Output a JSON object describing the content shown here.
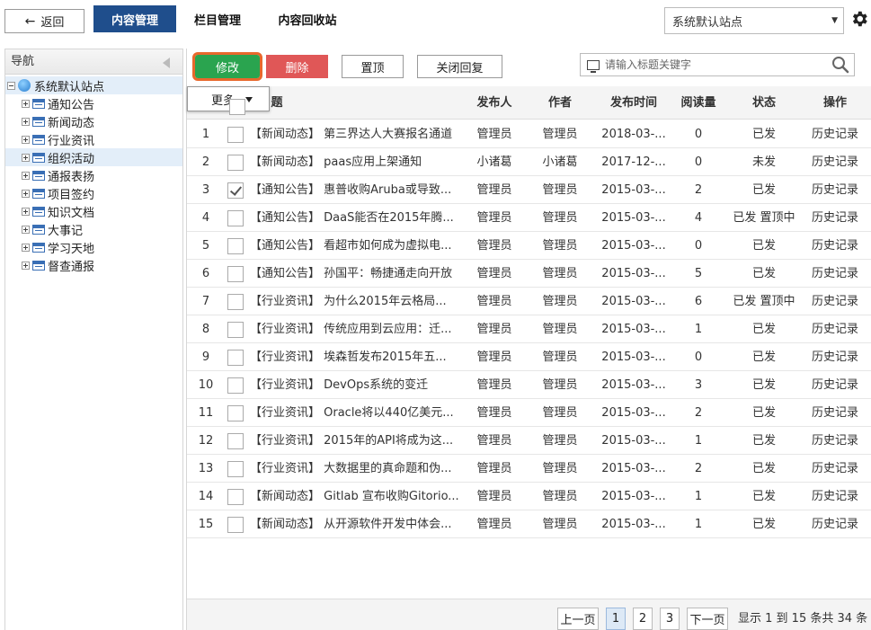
{
  "topbar": {
    "back_label": "返回",
    "tabs": [
      {
        "label": "内容管理",
        "active": true
      },
      {
        "label": "栏目管理",
        "active": false
      },
      {
        "label": "内容回收站",
        "active": false
      }
    ],
    "site_select_value": "系统默认站点"
  },
  "nav": {
    "title": "导航",
    "root": "系统默认站点",
    "items": [
      {
        "label": "通知公告"
      },
      {
        "label": "新闻动态"
      },
      {
        "label": "行业资讯"
      },
      {
        "label": "组织活动"
      },
      {
        "label": "通报表扬"
      },
      {
        "label": "项目签约"
      },
      {
        "label": "知识文档"
      },
      {
        "label": "大事记"
      },
      {
        "label": "学习天地"
      },
      {
        "label": "督查通报"
      }
    ]
  },
  "toolbar": {
    "edit_label": "修改",
    "delete_label": "删除",
    "pin_label": "置顶",
    "close_reply_label": "关闭回复",
    "search_placeholder": "请输入标题关键字",
    "more_label": "更多"
  },
  "table": {
    "headers": {
      "title": "题",
      "publisher": "发布人",
      "author": "作者",
      "date": "发布时间",
      "reads": "阅读量",
      "status": "状态",
      "action": "操作"
    },
    "rows": [
      {
        "num": "1",
        "title": "【新闻动态】 第三界达人大赛报名通道",
        "publisher": "管理员",
        "author": "管理员",
        "date": "2018-03-...",
        "reads": "0",
        "status": "已发",
        "action": "历史记录",
        "checked": false
      },
      {
        "num": "2",
        "title": "【新闻动态】 paas应用上架通知",
        "publisher": "小诸葛",
        "author": "小诸葛",
        "date": "2017-12-...",
        "reads": "0",
        "status": "未发",
        "action": "历史记录",
        "checked": false
      },
      {
        "num": "3",
        "title": "【通知公告】 惠普收购Aruba或导致...",
        "publisher": "管理员",
        "author": "管理员",
        "date": "2015-03-...",
        "reads": "2",
        "status": "已发",
        "action": "历史记录",
        "checked": true
      },
      {
        "num": "4",
        "title": "【通知公告】 DaaS能否在2015年腾...",
        "publisher": "管理员",
        "author": "管理员",
        "date": "2015-03-...",
        "reads": "4",
        "status": "已发 置顶中",
        "action": "历史记录",
        "checked": false
      },
      {
        "num": "5",
        "title": "【通知公告】 看超市如何成为虚拟电...",
        "publisher": "管理员",
        "author": "管理员",
        "date": "2015-03-...",
        "reads": "0",
        "status": "已发",
        "action": "历史记录",
        "checked": false
      },
      {
        "num": "6",
        "title": "【通知公告】 孙国平：畅捷通走向开放",
        "publisher": "管理员",
        "author": "管理员",
        "date": "2015-03-...",
        "reads": "5",
        "status": "已发",
        "action": "历史记录",
        "checked": false
      },
      {
        "num": "7",
        "title": "【行业资讯】 为什么2015年云格局...",
        "publisher": "管理员",
        "author": "管理员",
        "date": "2015-03-...",
        "reads": "6",
        "status": "已发 置顶中",
        "action": "历史记录",
        "checked": false
      },
      {
        "num": "8",
        "title": "【行业资讯】 传统应用到云应用：迁...",
        "publisher": "管理员",
        "author": "管理员",
        "date": "2015-03-...",
        "reads": "1",
        "status": "已发",
        "action": "历史记录",
        "checked": false
      },
      {
        "num": "9",
        "title": "【行业资讯】 埃森哲发布2015年五...",
        "publisher": "管理员",
        "author": "管理员",
        "date": "2015-03-...",
        "reads": "0",
        "status": "已发",
        "action": "历史记录",
        "checked": false
      },
      {
        "num": "10",
        "title": "【行业资讯】 DevOps系统的变迁",
        "publisher": "管理员",
        "author": "管理员",
        "date": "2015-03-...",
        "reads": "3",
        "status": "已发",
        "action": "历史记录",
        "checked": false
      },
      {
        "num": "11",
        "title": "【行业资讯】 Oracle将以440亿美元...",
        "publisher": "管理员",
        "author": "管理员",
        "date": "2015-03-...",
        "reads": "2",
        "status": "已发",
        "action": "历史记录",
        "checked": false
      },
      {
        "num": "12",
        "title": "【行业资讯】 2015年的API将成为这...",
        "publisher": "管理员",
        "author": "管理员",
        "date": "2015-03-...",
        "reads": "1",
        "status": "已发",
        "action": "历史记录",
        "checked": false
      },
      {
        "num": "13",
        "title": "【行业资讯】 大数据里的真命题和伪...",
        "publisher": "管理员",
        "author": "管理员",
        "date": "2015-03-...",
        "reads": "2",
        "status": "已发",
        "action": "历史记录",
        "checked": false
      },
      {
        "num": "14",
        "title": "【新闻动态】 Gitlab 宣布收购Gitorio...",
        "publisher": "管理员",
        "author": "管理员",
        "date": "2015-03-...",
        "reads": "1",
        "status": "已发",
        "action": "历史记录",
        "checked": false
      },
      {
        "num": "15",
        "title": "【新闻动态】 从开源软件开发中体会...",
        "publisher": "管理员",
        "author": "管理员",
        "date": "2015-03-...",
        "reads": "1",
        "status": "已发",
        "action": "历史记录",
        "checked": false
      }
    ]
  },
  "pager": {
    "prev": "上一页",
    "pages": [
      "1",
      "2",
      "3"
    ],
    "current": "1",
    "next": "下一页",
    "info": "显示 1 到 15 条共 34 条"
  },
  "colors": {
    "active_tab": "#1f4e8c",
    "edit_button": "#2aa44f",
    "delete_button": "#e05757",
    "edit_outline": "#e8682c"
  },
  "icons": {
    "back": "left-arrow-icon",
    "settings": "gear-icon",
    "search": "search-icon",
    "monitor": "monitor-icon",
    "site_root": "globe-icon",
    "category": "document-icon"
  }
}
